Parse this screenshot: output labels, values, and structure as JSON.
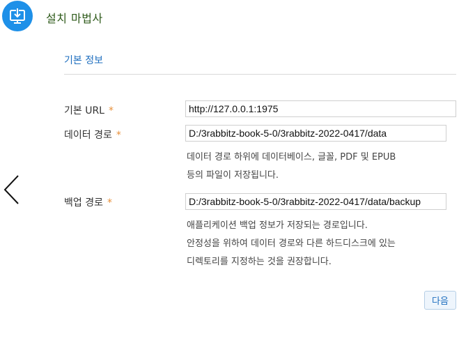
{
  "header": {
    "title": "설치 마법사",
    "icon": "download-install-icon",
    "accent_color": "#1e90e8"
  },
  "section": {
    "title": "기본 정보"
  },
  "fields": {
    "base_url": {
      "label": "기본 URL",
      "required_mark": "*",
      "value": "http://127.0.0.1:1975"
    },
    "data_path": {
      "label": "데이터 경로",
      "required_mark": "*",
      "value": "D:/3rabbitz-book-5-0/3rabbitz-2022-0417/data",
      "help_lines": [
        "데이터 경로 하위에 데이터베이스, 글꼴, PDF 및 EPUB",
        "등의 파일이 저장됩니다."
      ]
    },
    "backup_path": {
      "label": "백업 경로",
      "required_mark": "*",
      "value": "D:/3rabbitz-book-5-0/3rabbitz-2022-0417/data/backup",
      "help_lines": [
        "애플리케이션 백업 정보가 저장되는 경로입니다.",
        "안정성을 위하여 데이터 경로와 다른 하드디스크에 있는",
        "디렉토리를 지정하는 것을 권장합니다."
      ]
    }
  },
  "navigation": {
    "back_icon": "chevron-left-icon",
    "next_label": "다음"
  }
}
